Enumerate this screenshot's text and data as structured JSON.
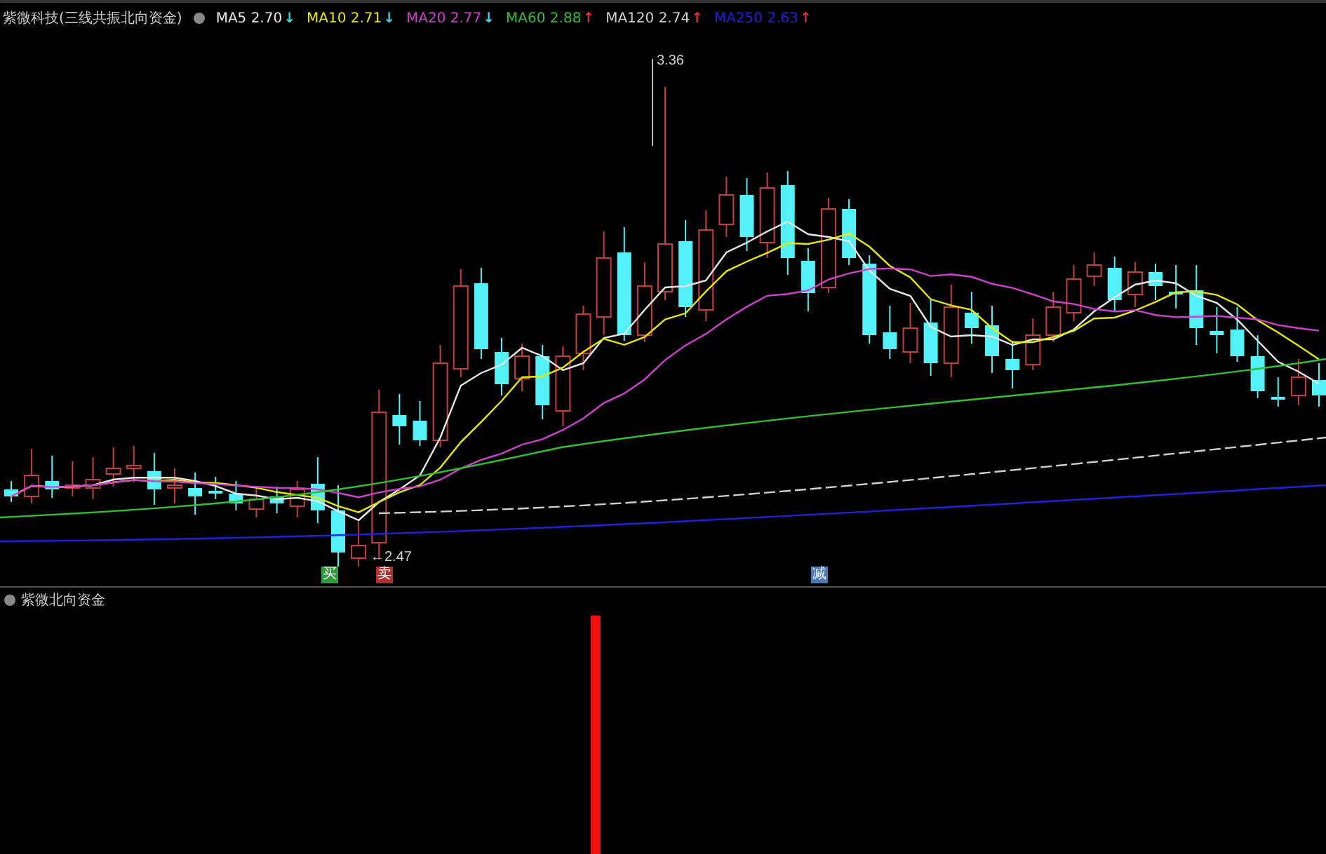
{
  "upper_pane": {
    "title": "紫微科技(三线共振北向资金)",
    "legend": [
      {
        "label": "MA5",
        "value": "2.70",
        "arrow": "↓",
        "rising": false,
        "color": "#e8e8e8"
      },
      {
        "label": "MA10",
        "value": "2.71",
        "arrow": "↓",
        "rising": false,
        "color": "#e8e800"
      },
      {
        "label": "MA20",
        "value": "2.77",
        "arrow": "↓",
        "rising": false,
        "color": "#d040d0"
      },
      {
        "label": "MA60",
        "value": "2.88",
        "arrow": "↑",
        "rising": true,
        "color": "#30c030"
      },
      {
        "label": "MA120",
        "value": "2.74",
        "arrow": "↑",
        "rising": true,
        "color": "#d0d0d0"
      },
      {
        "label": "MA250",
        "value": "2.63",
        "arrow": "↑",
        "rising": true,
        "color": "#2020e0"
      }
    ],
    "high_label": "3.36",
    "low_label": "←2.47",
    "signals": [
      {
        "label": "买",
        "color": "#2e9e3a"
      },
      {
        "label": "卖",
        "color": "#b03030"
      },
      {
        "label": "减",
        "color": "#4a78b8"
      }
    ]
  },
  "lower_pane": {
    "title": "紫微北向资金"
  }
}
